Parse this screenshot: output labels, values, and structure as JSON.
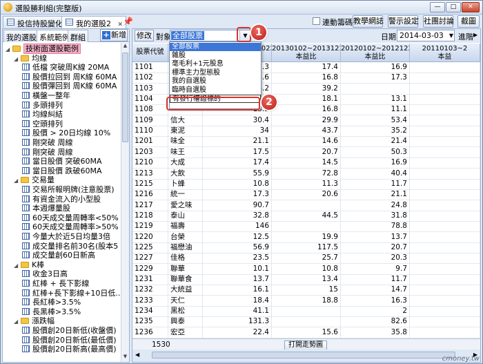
{
  "window": {
    "title": "選股勝利組(完整版)",
    "controls": [
      "—",
      "□",
      "✕"
    ]
  },
  "tabs": [
    {
      "label": "投信持股變化"
    },
    {
      "label": "我的選股2"
    }
  ],
  "topbar": {
    "sync_label": "連動籌碼K",
    "buttons": [
      "教學網誌",
      "警示設定",
      "社團討論",
      "截圖"
    ]
  },
  "sidebar": {
    "subtabs": [
      "我的選股",
      "系統範例",
      "群組"
    ],
    "new_label": "新增",
    "tree": [
      {
        "level": 0,
        "type": "folder",
        "label": "技術面選股範例",
        "selected": true
      },
      {
        "level": 1,
        "type": "folder",
        "label": "均線"
      },
      {
        "level": 2,
        "type": "item",
        "label": "低檔 突破周K線 20MA"
      },
      {
        "level": 2,
        "type": "item",
        "label": "股價拉回到 周K線 60MA"
      },
      {
        "level": 2,
        "type": "item",
        "label": "股價彈回到 周K線 60MA"
      },
      {
        "level": 2,
        "type": "item",
        "label": "橫盤一整年"
      },
      {
        "level": 2,
        "type": "item",
        "label": "多頭排列"
      },
      {
        "level": 2,
        "type": "item",
        "label": "均線糾結"
      },
      {
        "level": 2,
        "type": "item",
        "label": "空頭排列"
      },
      {
        "level": 2,
        "type": "item",
        "label": "股價 > 20日均線 10%"
      },
      {
        "level": 2,
        "type": "item",
        "label": "剛突破 周線"
      },
      {
        "level": 2,
        "type": "item",
        "label": "剛突破 周線"
      },
      {
        "level": 2,
        "type": "item",
        "label": "當日股價 突破60MA"
      },
      {
        "level": 2,
        "type": "item",
        "label": "當日股價 跌破60MA"
      },
      {
        "level": 1,
        "type": "folder",
        "label": "交易量"
      },
      {
        "level": 2,
        "type": "item",
        "label": "交易所報明牌(注意股票)"
      },
      {
        "level": 2,
        "type": "item",
        "label": "有資金流入的小型股"
      },
      {
        "level": 2,
        "type": "item",
        "label": "本週爆量股"
      },
      {
        "level": 2,
        "type": "item",
        "label": "60天成交量周轉率<50%"
      },
      {
        "level": 2,
        "type": "item",
        "label": "60天成交量周轉率>50%"
      },
      {
        "level": 2,
        "type": "item",
        "label": "今量大於近5日均量3倍"
      },
      {
        "level": 2,
        "type": "item",
        "label": "成交量排名前30名(股本5"
      },
      {
        "level": 2,
        "type": "item",
        "label": "成交量創60日新高"
      },
      {
        "level": 1,
        "type": "folder",
        "label": "K棒"
      },
      {
        "level": 2,
        "type": "item",
        "label": "收金3日高"
      },
      {
        "level": 2,
        "type": "item",
        "label": "紅棒 + 長下影線"
      },
      {
        "level": 2,
        "type": "item",
        "label": "紅棒+長下影線+10日低..."
      },
      {
        "level": 2,
        "type": "item",
        "label": "長紅棒>3.5%"
      },
      {
        "level": 2,
        "type": "item",
        "label": "長黑棒>3.5%"
      },
      {
        "level": 1,
        "type": "folder",
        "label": "漲跌幅"
      },
      {
        "level": 2,
        "type": "item",
        "label": "股價創20日新低(收盤價)"
      },
      {
        "level": 2,
        "type": "item",
        "label": "股價創20日新低(最低價)"
      },
      {
        "level": 2,
        "type": "item",
        "label": "股價創20日新高(最高價)"
      }
    ]
  },
  "filter": {
    "button_label": "修改",
    "target_label": "對象",
    "selected": "全部股票",
    "date_label": "日期",
    "date_value": "2014-03-03",
    "advanced_label": "進階"
  },
  "dropdown": {
    "options": [
      "全部股票",
      "雜股",
      "毫毛利+1元股息",
      "標準主力型態股",
      "我的自選股",
      "臨時自選股",
      "有發行權證標的"
    ],
    "highlighted_index": 0,
    "marked_index": 6
  },
  "callouts": {
    "badge1": "1",
    "badge2": "2"
  },
  "table": {
    "columns": [
      {
        "top": "股票代號",
        "bottom": ""
      },
      {
        "top": "",
        "bottom": ""
      },
      {
        "top": "20130102~20140227",
        "bottom": "本益比"
      },
      {
        "top": "20130102~20131231",
        "bottom": "本益比"
      },
      {
        "top": "20120102~20121228",
        "bottom": "本益比"
      },
      {
        "top": "20110103~2",
        "bottom": "本益"
      }
    ],
    "rows": [
      [
        "1101",
        "",
        "15.3",
        "17.4",
        "16.9",
        ""
      ],
      [
        "1102",
        "",
        "14.6",
        "16.8",
        "17.3",
        ""
      ],
      [
        "1103",
        "",
        "6.2",
        "39.2",
        "",
        ""
      ],
      [
        "1104",
        "",
        "15.2",
        "18.1",
        "13.1",
        ""
      ],
      [
        "1108",
        "",
        "15.2",
        "16.8",
        "11.1",
        ""
      ],
      [
        "1109",
        "信大",
        "30.4",
        "29.9",
        "53.4",
        ""
      ],
      [
        "1110",
        "東泥",
        "34",
        "43.7",
        "35.2",
        ""
      ],
      [
        "1201",
        "味全",
        "21.1",
        "14.6",
        "21.4",
        ""
      ],
      [
        "1203",
        "味王",
        "17.5",
        "20.7",
        "50.3",
        ""
      ],
      [
        "1210",
        "大成",
        "17.4",
        "14.5",
        "16.9",
        ""
      ],
      [
        "1213",
        "大飲",
        "55.9",
        "72.8",
        "40.4",
        ""
      ],
      [
        "1215",
        "卜蜂",
        "10.8",
        "11.3",
        "11.7",
        ""
      ],
      [
        "1216",
        "統一",
        "17.3",
        "20.6",
        "21.1",
        ""
      ],
      [
        "1217",
        "愛之味",
        "90.7",
        "",
        "24.8",
        ""
      ],
      [
        "1218",
        "泰山",
        "32.8",
        "44.5",
        "31.8",
        ""
      ],
      [
        "1219",
        "福壽",
        "146",
        "",
        "78.8",
        ""
      ],
      [
        "1220",
        "台榮",
        "12.5",
        "19.9",
        "13.7",
        ""
      ],
      [
        "1225",
        "福懋油",
        "56.9",
        "117.5",
        "20.7",
        ""
      ],
      [
        "1227",
        "佳格",
        "23.5",
        "25.7",
        "20.3",
        ""
      ],
      [
        "1229",
        "聯華",
        "10.1",
        "10.8",
        "9.7",
        ""
      ],
      [
        "1231",
        "聯華食",
        "13.7",
        "13.4",
        "11.7",
        ""
      ],
      [
        "1232",
        "大統益",
        "16.1",
        "15",
        "14.7",
        ""
      ],
      [
        "1233",
        "天仁",
        "18.4",
        "18.8",
        "16.3",
        ""
      ],
      [
        "1234",
        "黑松",
        "41.1",
        "",
        "2",
        ""
      ],
      [
        "1235",
        "興泰",
        "131.3",
        "",
        "82.6",
        ""
      ],
      [
        "1236",
        "宏亞",
        "22.4",
        "15.6",
        "35.8",
        ""
      ],
      [
        "1256",
        "F-鮮活",
        "16.3",
        "17.5",
        "13",
        ""
      ],
      [
        "1262",
        "F-綠悅",
        "",
        "",
        "",
        ""
      ]
    ]
  },
  "bottom": {
    "count": "1530",
    "chart_button": "打開走勢圖"
  },
  "watermark": "cmoney.tw"
}
